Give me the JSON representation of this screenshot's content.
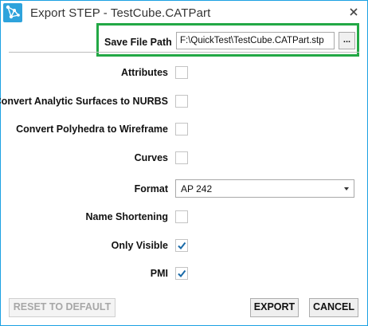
{
  "window": {
    "title": "Export STEP - TestCube.CATPart",
    "close_icon": "close-icon",
    "app_icon": "app-logo-icon",
    "accent": "#1ba1e2",
    "highlight_color": "#22a845"
  },
  "save_path": {
    "label": "Save File Path",
    "value": "F:\\QuickTest\\TestCube.CATPart.stp",
    "browse_label": "..."
  },
  "options": [
    {
      "label": "Attributes",
      "checked": false
    },
    {
      "label": "Convert Analytic Surfaces to NURBS",
      "checked": false
    },
    {
      "label": "Convert Polyhedra to Wireframe",
      "checked": false
    },
    {
      "label": "Curves",
      "checked": false
    },
    {
      "label": "Name Shortening",
      "checked": false
    },
    {
      "label": "Only Visible",
      "checked": true
    },
    {
      "label": "PMI",
      "checked": true
    }
  ],
  "format": {
    "label": "Format",
    "selected": "AP 242"
  },
  "buttons": {
    "reset": "RESET TO DEFAULT",
    "reset_enabled": false,
    "export": "EXPORT",
    "cancel": "CANCEL"
  }
}
